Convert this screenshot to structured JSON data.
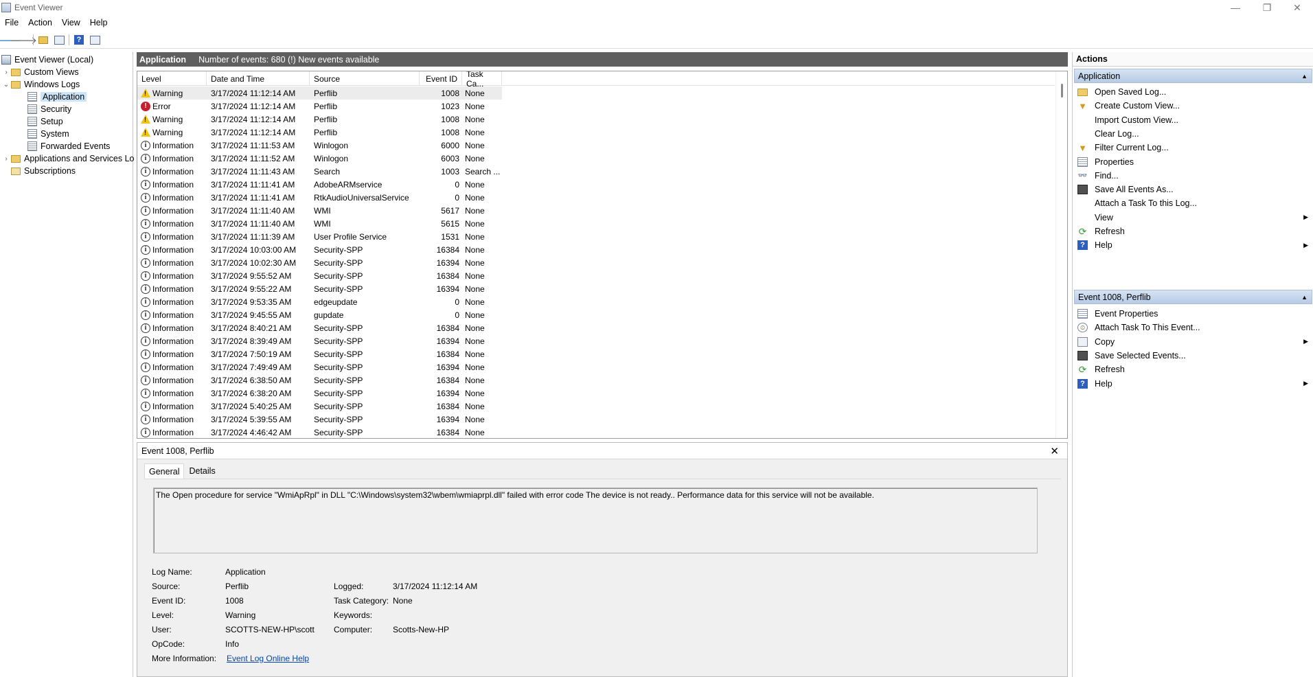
{
  "window": {
    "title": "Event Viewer",
    "minimize": "—",
    "maximize": "❐",
    "close": "✕"
  },
  "menu": [
    "File",
    "Action",
    "View",
    "Help"
  ],
  "tree": {
    "root": "Event Viewer (Local)",
    "custom_views": "Custom Views",
    "windows_logs": "Windows Logs",
    "application": "Application",
    "security": "Security",
    "setup": "Setup",
    "system": "System",
    "forwarded": "Forwarded Events",
    "apps_services": "Applications and Services Lo",
    "subscriptions": "Subscriptions"
  },
  "center": {
    "log_name": "Application",
    "status": "Number of events: 680 (!) New events available"
  },
  "columns": [
    "Level",
    "Date and Time",
    "Source",
    "Event ID",
    "Task Ca..."
  ],
  "events": [
    {
      "level": "Warning",
      "type": "warn",
      "date": "3/17/2024 11:12:14 AM",
      "source": "Perflib",
      "id": "1008",
      "task": "None"
    },
    {
      "level": "Error",
      "type": "err",
      "date": "3/17/2024 11:12:14 AM",
      "source": "Perflib",
      "id": "1023",
      "task": "None"
    },
    {
      "level": "Warning",
      "type": "warn",
      "date": "3/17/2024 11:12:14 AM",
      "source": "Perflib",
      "id": "1008",
      "task": "None"
    },
    {
      "level": "Warning",
      "type": "warn",
      "date": "3/17/2024 11:12:14 AM",
      "source": "Perflib",
      "id": "1008",
      "task": "None"
    },
    {
      "level": "Information",
      "type": "info",
      "date": "3/17/2024 11:11:53 AM",
      "source": "Winlogon",
      "id": "6000",
      "task": "None"
    },
    {
      "level": "Information",
      "type": "info",
      "date": "3/17/2024 11:11:52 AM",
      "source": "Winlogon",
      "id": "6003",
      "task": "None"
    },
    {
      "level": "Information",
      "type": "info",
      "date": "3/17/2024 11:11:43 AM",
      "source": "Search",
      "id": "1003",
      "task": "Search ..."
    },
    {
      "level": "Information",
      "type": "info",
      "date": "3/17/2024 11:11:41 AM",
      "source": "AdobeARMservice",
      "id": "0",
      "task": "None"
    },
    {
      "level": "Information",
      "type": "info",
      "date": "3/17/2024 11:11:41 AM",
      "source": "RtkAudioUniversalService",
      "id": "0",
      "task": "None"
    },
    {
      "level": "Information",
      "type": "info",
      "date": "3/17/2024 11:11:40 AM",
      "source": "WMI",
      "id": "5617",
      "task": "None"
    },
    {
      "level": "Information",
      "type": "info",
      "date": "3/17/2024 11:11:40 AM",
      "source": "WMI",
      "id": "5615",
      "task": "None"
    },
    {
      "level": "Information",
      "type": "info",
      "date": "3/17/2024 11:11:39 AM",
      "source": "User Profile Service",
      "id": "1531",
      "task": "None"
    },
    {
      "level": "Information",
      "type": "info",
      "date": "3/17/2024 10:03:00 AM",
      "source": "Security-SPP",
      "id": "16384",
      "task": "None"
    },
    {
      "level": "Information",
      "type": "info",
      "date": "3/17/2024 10:02:30 AM",
      "source": "Security-SPP",
      "id": "16394",
      "task": "None"
    },
    {
      "level": "Information",
      "type": "info",
      "date": "3/17/2024 9:55:52 AM",
      "source": "Security-SPP",
      "id": "16384",
      "task": "None"
    },
    {
      "level": "Information",
      "type": "info",
      "date": "3/17/2024 9:55:22 AM",
      "source": "Security-SPP",
      "id": "16394",
      "task": "None"
    },
    {
      "level": "Information",
      "type": "info",
      "date": "3/17/2024 9:53:35 AM",
      "source": "edgeupdate",
      "id": "0",
      "task": "None"
    },
    {
      "level": "Information",
      "type": "info",
      "date": "3/17/2024 9:45:55 AM",
      "source": "gupdate",
      "id": "0",
      "task": "None"
    },
    {
      "level": "Information",
      "type": "info",
      "date": "3/17/2024 8:40:21 AM",
      "source": "Security-SPP",
      "id": "16384",
      "task": "None"
    },
    {
      "level": "Information",
      "type": "info",
      "date": "3/17/2024 8:39:49 AM",
      "source": "Security-SPP",
      "id": "16394",
      "task": "None"
    },
    {
      "level": "Information",
      "type": "info",
      "date": "3/17/2024 7:50:19 AM",
      "source": "Security-SPP",
      "id": "16384",
      "task": "None"
    },
    {
      "level": "Information",
      "type": "info",
      "date": "3/17/2024 7:49:49 AM",
      "source": "Security-SPP",
      "id": "16394",
      "task": "None"
    },
    {
      "level": "Information",
      "type": "info",
      "date": "3/17/2024 6:38:50 AM",
      "source": "Security-SPP",
      "id": "16384",
      "task": "None"
    },
    {
      "level": "Information",
      "type": "info",
      "date": "3/17/2024 6:38:20 AM",
      "source": "Security-SPP",
      "id": "16394",
      "task": "None"
    },
    {
      "level": "Information",
      "type": "info",
      "date": "3/17/2024 5:40:25 AM",
      "source": "Security-SPP",
      "id": "16384",
      "task": "None"
    },
    {
      "level": "Information",
      "type": "info",
      "date": "3/17/2024 5:39:55 AM",
      "source": "Security-SPP",
      "id": "16394",
      "task": "None"
    },
    {
      "level": "Information",
      "type": "info",
      "date": "3/17/2024 4:46:42 AM",
      "source": "Security-SPP",
      "id": "16384",
      "task": "None"
    }
  ],
  "detail": {
    "title": "Event 1008, Perflib",
    "tabs": [
      "General",
      "Details"
    ],
    "message": "The Open procedure for service \"WmiApRpl\" in DLL \"C:\\Windows\\system32\\wbem\\wmiaprpl.dll\" failed with error code The device is not ready.. Performance data for this service will not be available.",
    "labels": {
      "log_name": "Log Name:",
      "source": "Source:",
      "event_id": "Event ID:",
      "level": "Level:",
      "user": "User:",
      "opcode": "OpCode:",
      "more_info": "More Information:",
      "logged": "Logged:",
      "task_category": "Task Category:",
      "keywords": "Keywords:",
      "computer": "Computer:"
    },
    "values": {
      "log_name": "Application",
      "source": "Perflib",
      "event_id": "1008",
      "level": "Warning",
      "user": "SCOTTS-NEW-HP\\scott",
      "opcode": "Info",
      "more_info": "Event Log Online Help",
      "logged": "3/17/2024 11:12:14 AM",
      "task_category": "None",
      "keywords": "",
      "computer": "Scotts-New-HP"
    }
  },
  "actions": {
    "title": "Actions",
    "section1": {
      "header": "Application",
      "items": [
        {
          "label": "Open Saved Log...",
          "icon": "folder"
        },
        {
          "label": "Create Custom View...",
          "icon": "filter"
        },
        {
          "label": "Import Custom View...",
          "icon": "blank"
        },
        {
          "label": "Clear Log...",
          "icon": "blank"
        },
        {
          "label": "Filter Current Log...",
          "icon": "filter"
        },
        {
          "label": "Properties",
          "icon": "props"
        },
        {
          "label": "Find...",
          "icon": "find"
        },
        {
          "label": "Save All Events As...",
          "icon": "save"
        },
        {
          "label": "Attach a Task To this Log...",
          "icon": "blank"
        },
        {
          "label": "View",
          "icon": "blank",
          "submenu": true
        },
        {
          "label": "Refresh",
          "icon": "refresh"
        },
        {
          "label": "Help",
          "icon": "help",
          "submenu": true
        }
      ]
    },
    "section2": {
      "header": "Event 1008, Perflib",
      "items": [
        {
          "label": "Event Properties",
          "icon": "props"
        },
        {
          "label": "Attach Task To This Event...",
          "icon": "task"
        },
        {
          "label": "Copy",
          "icon": "copy",
          "submenu": true
        },
        {
          "label": "Save Selected Events...",
          "icon": "save"
        },
        {
          "label": "Refresh",
          "icon": "refresh"
        },
        {
          "label": "Help",
          "icon": "help",
          "submenu": true
        }
      ]
    }
  }
}
